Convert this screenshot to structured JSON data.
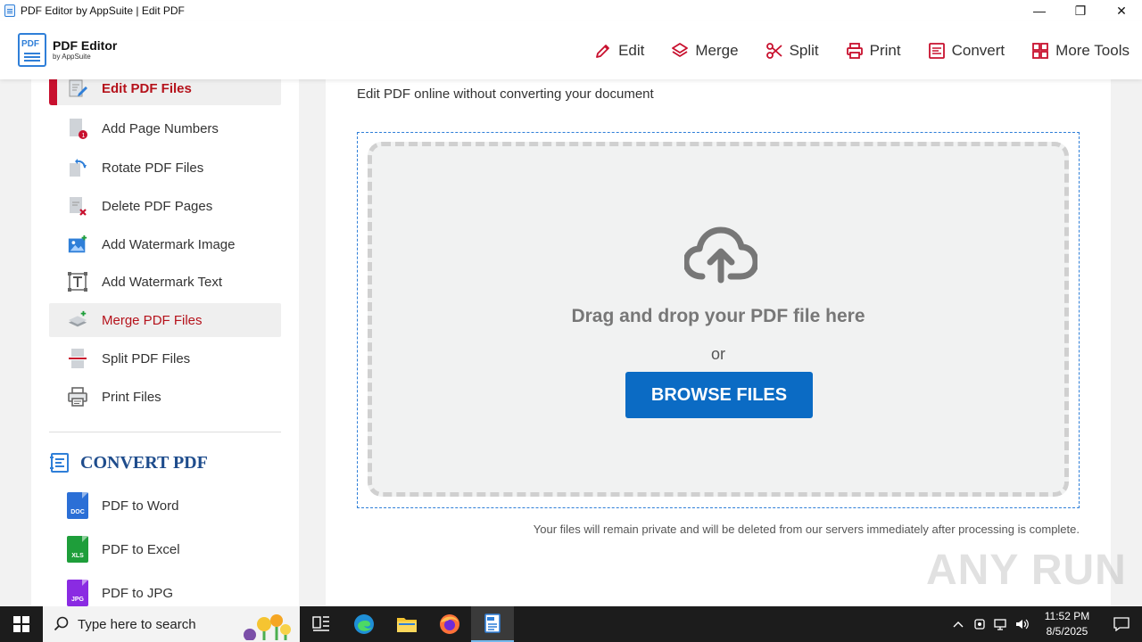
{
  "window": {
    "title": "PDF Editor by AppSuite | Edit PDF",
    "controls": {
      "minimize": "—",
      "maximize": "❐",
      "close": "✕"
    }
  },
  "header": {
    "logo_title": "PDF Editor",
    "logo_subtitle": "by AppSuite",
    "logo_mark_text": "PDF",
    "nav": [
      {
        "label": "Edit",
        "icon": "pencil-icon"
      },
      {
        "label": "Merge",
        "icon": "layers-icon"
      },
      {
        "label": "Split",
        "icon": "scissors-icon"
      },
      {
        "label": "Print",
        "icon": "printer-icon"
      },
      {
        "label": "Convert",
        "icon": "convert-icon"
      },
      {
        "label": "More Tools",
        "icon": "grid-icon"
      }
    ]
  },
  "sidebar": {
    "items": [
      {
        "label": "Edit PDF Files",
        "icon": "edit-doc-icon",
        "state": "active"
      },
      {
        "label": "Add Page Numbers",
        "icon": "page-number-icon"
      },
      {
        "label": "Rotate PDF Files",
        "icon": "rotate-icon"
      },
      {
        "label": "Delete PDF Pages",
        "icon": "delete-page-icon"
      },
      {
        "label": "Add Watermark Image",
        "icon": "image-plus-icon"
      },
      {
        "label": "Add Watermark Text",
        "icon": "text-box-icon"
      },
      {
        "label": "Merge PDF Files",
        "icon": "merge-layers-icon",
        "state": "hover"
      },
      {
        "label": "Split PDF Files",
        "icon": "split-page-icon"
      },
      {
        "label": "Print Files",
        "icon": "printer-icon"
      }
    ],
    "convert_heading": "CONVERT PDF",
    "convert_items": [
      {
        "label": "PDF to Word",
        "badge": "DOC",
        "color": "#2b6fd6"
      },
      {
        "label": "PDF to Excel",
        "badge": "XLS",
        "color": "#1e9e3a"
      },
      {
        "label": "PDF to JPG",
        "badge": "JPG",
        "color": "#8a2be2"
      }
    ]
  },
  "main": {
    "description": "Edit PDF online without converting your document",
    "drop_text": "Drag and drop your PDF file here",
    "or_text": "or",
    "browse_label": "BROWSE FILES",
    "privacy_note": "Your files will remain private and will be deleted from our servers immediately after processing is complete."
  },
  "watermark": "ANY RUN",
  "taskbar": {
    "search_placeholder": "Type here to search",
    "time": "11:52 PM",
    "date": "8/5/2025",
    "apps": [
      "task-view-icon",
      "edge-icon",
      "file-explorer-icon",
      "firefox-icon",
      "pdf-editor-icon"
    ]
  },
  "colors": {
    "accent_red": "#c8102e",
    "accent_blue": "#0b6bc4",
    "heading_blue": "#1e4c8c",
    "taskbar": "#1c1c1c"
  }
}
